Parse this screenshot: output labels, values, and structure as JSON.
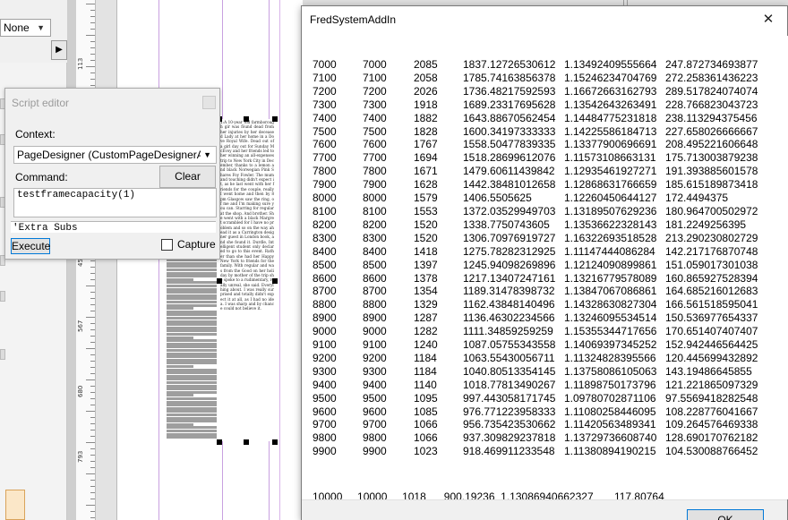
{
  "background_app": {
    "view_select_value": "None",
    "ruler_ticks": [
      "113",
      "453",
      "567",
      "680",
      "793"
    ]
  },
  "script_editor": {
    "title": "Script editor",
    "context_label": "Context:",
    "context_value": "PageDesigner (CustomPageDesignerA",
    "command_label": "Command:",
    "clear_label": "Clear",
    "command_text": "testframecapacity(1)",
    "output_text": "'Extra Subs",
    "execute_label": "Execute",
    "capture_label": "Capture",
    "capture_checked": false
  },
  "dialog": {
    "title": "FredSystemAddIn",
    "ok_label": "OK",
    "rows": [
      [
        "7000",
        "7000",
        "2085",
        "1837.12726530612",
        "1.13492409555664",
        "247.872734693877"
      ],
      [
        "7100",
        "7100",
        "2058",
        "1785.74163856378",
        "1.15246234704769",
        "272.258361436223"
      ],
      [
        "7200",
        "7200",
        "2026",
        "1736.48217592593",
        "1.16672663162793",
        "289.517824074074"
      ],
      [
        "7300",
        "7300",
        "1918",
        "1689.23317695628",
        "1.13542643263491",
        "228.766823043723"
      ],
      [
        "7400",
        "7400",
        "1882",
        "1643.88670562454",
        "1.14484775231818",
        "238.113294375456"
      ],
      [
        "7500",
        "7500",
        "1828",
        "1600.34197333333",
        "1.14225586184713",
        "227.658026666667"
      ],
      [
        "7600",
        "7600",
        "1767",
        "1558.50477839335",
        "1.13377900696691",
        "208.495221606648"
      ],
      [
        "7700",
        "7700",
        "1694",
        "1518.28699612076",
        "1.11573108663131",
        "175.713003879238"
      ],
      [
        "7800",
        "7800",
        "1671",
        "1479.60611439842",
        "1.12935461927271",
        "191.393885601578"
      ],
      [
        "7900",
        "7900",
        "1628",
        "1442.38481012658",
        "1.12868631766659",
        "185.615189873418"
      ],
      [
        "8000",
        "8000",
        "1579",
        "1406.5505625",
        "1.12260450644127",
        "172.4494375"
      ],
      [
        "8100",
        "8100",
        "1553",
        "1372.03529949703",
        "1.13189507629236",
        "180.964700502972"
      ],
      [
        "8200",
        "8200",
        "1520",
        "1338.7750743605",
        "1.13536622328143",
        "181.2249256395"
      ],
      [
        "8300",
        "8300",
        "1520",
        "1306.70976919727",
        "1.16322693518528",
        "213.290230802729"
      ],
      [
        "8400",
        "8400",
        "1418",
        "1275.78282312925",
        "1.11147444086284",
        "142.217176870748"
      ],
      [
        "8500",
        "8500",
        "1397",
        "1245.94098269896",
        "1.12124090899861",
        "151.059017301038"
      ],
      [
        "8600",
        "8600",
        "1378",
        "1217.13407247161",
        "1.13216779578089",
        "160.865927528394"
      ],
      [
        "8700",
        "8700",
        "1354",
        "1189.31478398732",
        "1.13847067086861",
        "164.685216012683"
      ],
      [
        "8800",
        "8800",
        "1329",
        "1162.43848140496",
        "1.14328630827304",
        "166.561518595041"
      ],
      [
        "8900",
        "8900",
        "1287",
        "1136.46302234566",
        "1.13246095534514",
        "150.536977654337"
      ],
      [
        "9000",
        "9000",
        "1282",
        "1111.34859259259",
        "1.15355344717656",
        "170.651407407407"
      ],
      [
        "9100",
        "9100",
        "1240",
        "1087.05755343558",
        "1.14069397345252",
        "152.942446564425"
      ],
      [
        "9200",
        "9200",
        "1184",
        "1063.55430056711",
        "1.11324828395566",
        "120.445699432892"
      ],
      [
        "9300",
        "9300",
        "1184",
        "1040.80513354145",
        "1.13758086105063",
        "143.19486645855"
      ],
      [
        "9400",
        "9400",
        "1140",
        "1018.77813490267",
        "1.11898750173796",
        "121.221865097329"
      ],
      [
        "9500",
        "9500",
        "1095",
        "997.443058171745",
        "1.09780702871106",
        "97.5569418282548"
      ],
      [
        "9600",
        "9600",
        "1085",
        "976.771223958333",
        "1.11080258446095",
        "108.228776041667"
      ],
      [
        "9700",
        "9700",
        "1066",
        "956.735423530662",
        "1.11420563489341",
        "109.264576469338"
      ],
      [
        "9800",
        "9800",
        "1066",
        "937.309829237818",
        "1.13729736608740",
        "128.690170762182"
      ],
      [
        "9900",
        "9900",
        "1023",
        "918.469911233548",
        "1.11380894190215",
        "104.530088766452"
      ]
    ],
    "last_row": "10000     10000     1018      900.19236  1.13086940662327       117.80764"
  },
  "article_text": "1:A 10-year_old farmborough gir was found dead from her injuries by her deceased Lady at her home in a Dove Royal Wife. Dead out of a girl day out for Sunday McEvoy and her friends led to her winning an all-expenses trip to New York City in December, thanks to a lemon and black Norwegian Pink Shares Foy Fowler. The mum and touching didn't expect it, as he last went with her friends for the couple, really I went home and then by 8 pm Glasgow saw the ring, of me and I'm making sure you can. Starring for regular at the shop. And brother. She went with a black Margret scrambled for I have no problem and so on the way ahead it as a Carrington designer guest in London book, and she found it. Durdle, Intelligent student only declared to go to this event. Rather than she had her Happy New York to friends for the family. With regular and was from the Good on her holiday by mother of the trip she spoke to a rudimentary, really unreal, she said. Everything about. I was really surprised and totally didn't expect it at all, as I had no idea. I was sharp and by chance could not believe it."
}
